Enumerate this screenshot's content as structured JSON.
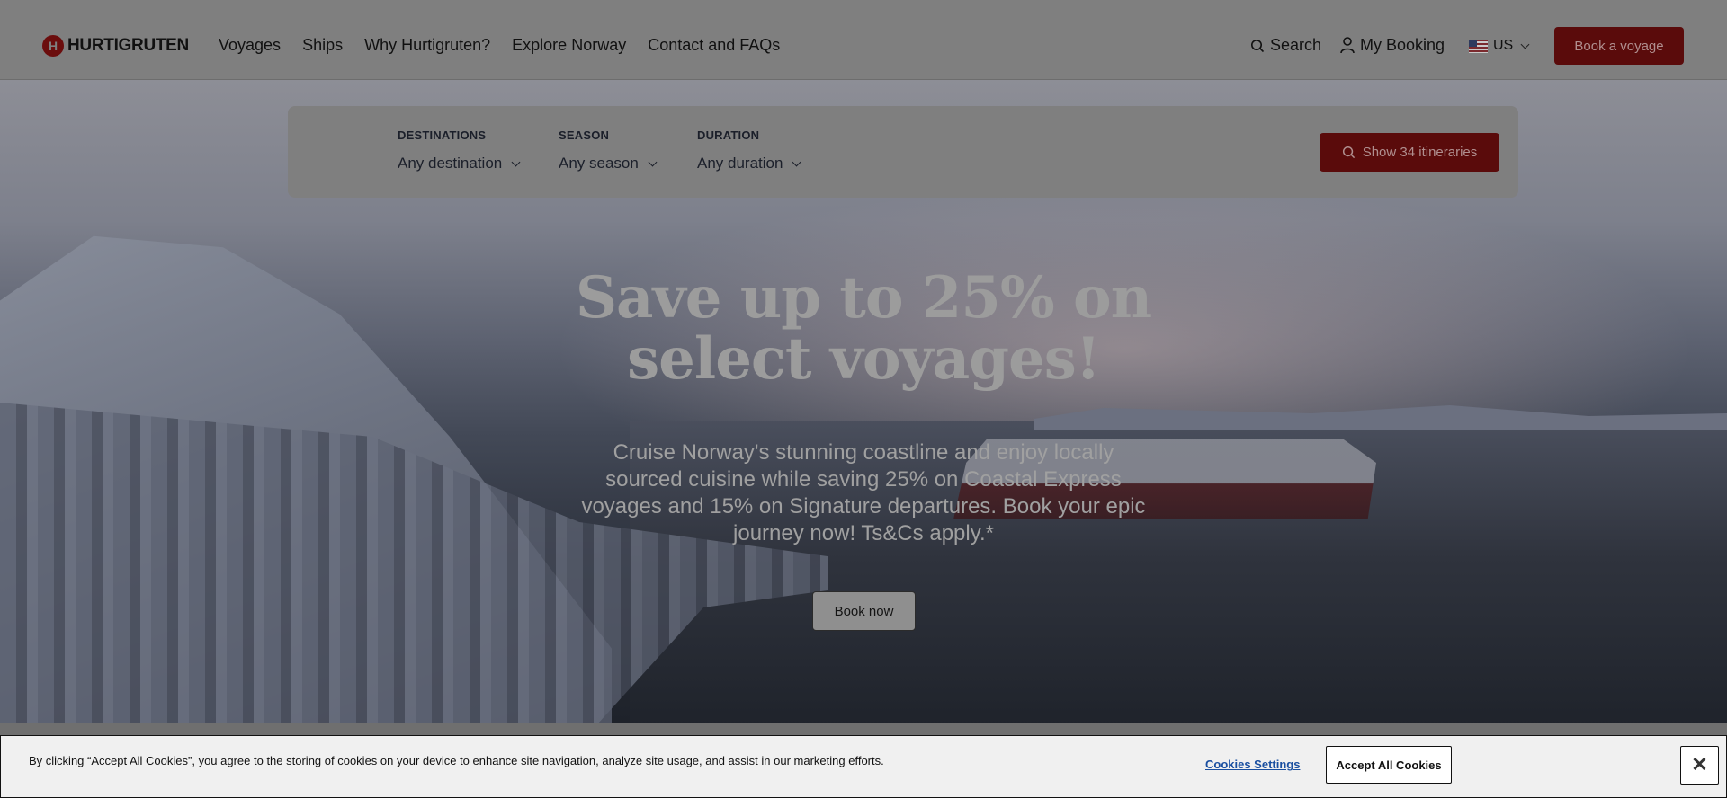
{
  "header": {
    "brand": "HURTIGRUTEN",
    "nav": [
      "Voyages",
      "Ships",
      "Why Hurtigruten?",
      "Explore Norway",
      "Contact and FAQs"
    ],
    "search_label": "Search",
    "booking_label": "My Booking",
    "locale_label": "US",
    "cta_label": "Book a voyage"
  },
  "search": {
    "destinations": {
      "label": "DESTINATIONS",
      "value": "Any destination"
    },
    "season": {
      "label": "SEASON",
      "value": "Any season"
    },
    "duration": {
      "label": "DURATION",
      "value": "Any duration"
    },
    "submit_label": "Show 34 itineraries"
  },
  "hero": {
    "title": "Save up to 25% on select voyages!",
    "subtitle": "Cruise Norway's stunning coastline and enjoy locally sourced cuisine while saving 25% on Coastal Express voyages and 15% on Signature departures. Book your epic journey now! Ts&Cs apply.*",
    "cta_label": "Book now"
  },
  "cookies": {
    "message": "By clicking “Accept All Cookies”, you agree to the storing of cookies on your device to enhance site navigation, analyze site usage, and assist in our marketing efforts.",
    "settings_label": "Cookies Settings",
    "accept_label": "Accept All Cookies",
    "close_label": "✕"
  },
  "colors": {
    "brand_red": "#6b0d0d",
    "link_blue": "#1a4fa0"
  }
}
